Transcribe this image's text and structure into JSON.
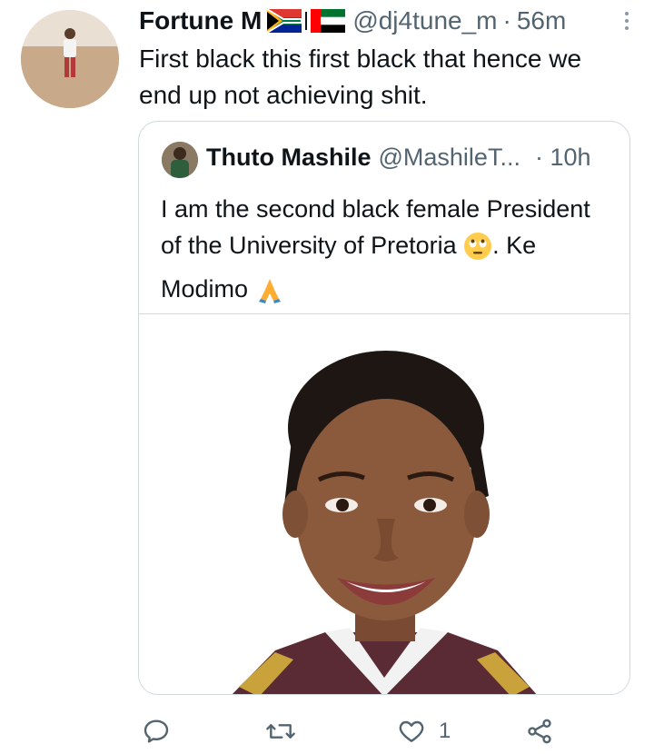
{
  "tweet": {
    "author_name": "Fortune M",
    "handle": "@dj4tune_m",
    "separator": "·",
    "time": "56m",
    "flags": [
      "south-africa-flag",
      "uae-flag"
    ],
    "text": "First black this first black that hence we\nend up not achieving shit."
  },
  "quoted_tweet": {
    "author_name": "Thuto Mashile",
    "handle": "@MashileT...",
    "time": "· 10h",
    "text_main": "I am the second black female President of the University of Pretoria",
    "text_end": ". Ke Modimo",
    "emojis": [
      "face-with-rolling-eyes",
      "folded-hands"
    ]
  },
  "actions": {
    "reply_icon": "reply-icon",
    "retweet_icon": "retweet-icon",
    "like_icon": "heart-icon",
    "like_count": "1",
    "share_icon": "share-icon"
  },
  "colors": {
    "secondary_text": "#536471",
    "border": "#cfd9de"
  }
}
